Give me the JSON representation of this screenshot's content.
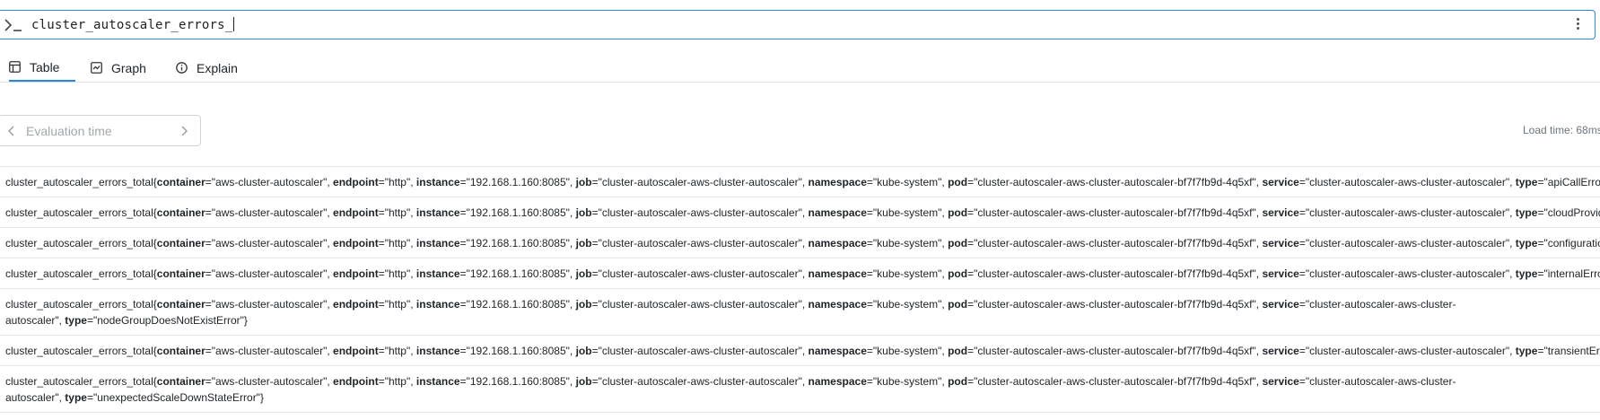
{
  "query": {
    "value": "cluster_autoscaler_errors_"
  },
  "tabs": [
    {
      "label": "Table",
      "icon": "table-icon",
      "active": true
    },
    {
      "label": "Graph",
      "icon": "graph-icon",
      "active": false
    },
    {
      "label": "Explain",
      "icon": "info-icon",
      "active": false
    }
  ],
  "evaluation": {
    "placeholder": "Evaluation time"
  },
  "load_time": "Load time: 68ms",
  "metric_name": "cluster_autoscaler_errors_total",
  "common_labels": [
    {
      "name": "container",
      "value": "aws-cluster-autoscaler"
    },
    {
      "name": "endpoint",
      "value": "http"
    },
    {
      "name": "instance",
      "value": "192.168.1.160:8085"
    },
    {
      "name": "job",
      "value": "cluster-autoscaler-aws-cluster-autoscaler"
    },
    {
      "name": "namespace",
      "value": "kube-system"
    },
    {
      "name": "pod",
      "value": "cluster-autoscaler-aws-cluster-autoscaler-bf7f7fb9d-4q5xf"
    },
    {
      "name": "service",
      "value": "cluster-autoscaler-aws-cluster-autoscaler"
    }
  ],
  "rows": [
    {
      "type": "apiCallError",
      "wrapped": false
    },
    {
      "type": "cloudProviderError",
      "wrapped": false
    },
    {
      "type": "configurationError",
      "wrapped": false
    },
    {
      "type": "internalError",
      "wrapped": false
    },
    {
      "type": "nodeGroupDoesNotExistError",
      "wrapped": true
    },
    {
      "type": "transientError",
      "wrapped": false
    },
    {
      "type": "unexpectedScaleDownStateError",
      "wrapped": true
    }
  ],
  "colors": {
    "accent": "#2f86d6",
    "border": "#dee2e6"
  }
}
